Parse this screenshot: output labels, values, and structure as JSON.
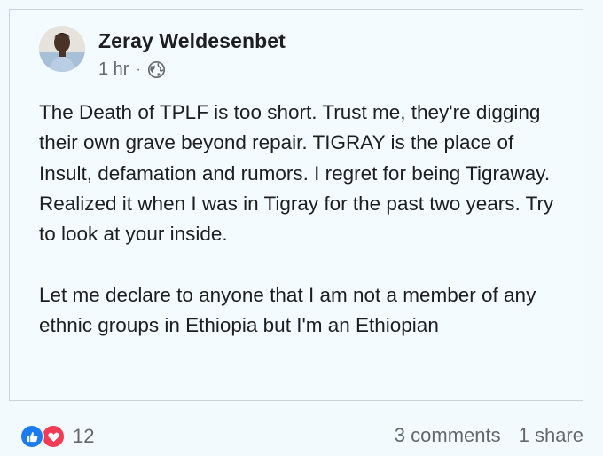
{
  "post": {
    "author": "Zeray Weldesenbet",
    "time": "1 hr",
    "separator": "·",
    "paragraph_1": "The Death of TPLF is too short. Trust me, they're digging their own grave beyond repair. TIGRAY is the place of Insult, defamation and rumors. I regret for being Tigraway. Realized it when I was in Tigray for the past two years. Try to look at your inside.",
    "paragraph_2": "Let me declare to anyone that I am not a member of any ethnic groups in Ethiopia but I'm an Ethiopian"
  },
  "footer": {
    "reaction_icons": [
      "like-icon",
      "love-icon"
    ],
    "reaction_count": "12",
    "comments": "3 comments",
    "shares": "1 share"
  },
  "colors": {
    "background": "#f2fafe",
    "like": "#1d7bf2",
    "love": "#f23b55",
    "meta_text": "#65676b",
    "body_text": "#1c1e21"
  }
}
